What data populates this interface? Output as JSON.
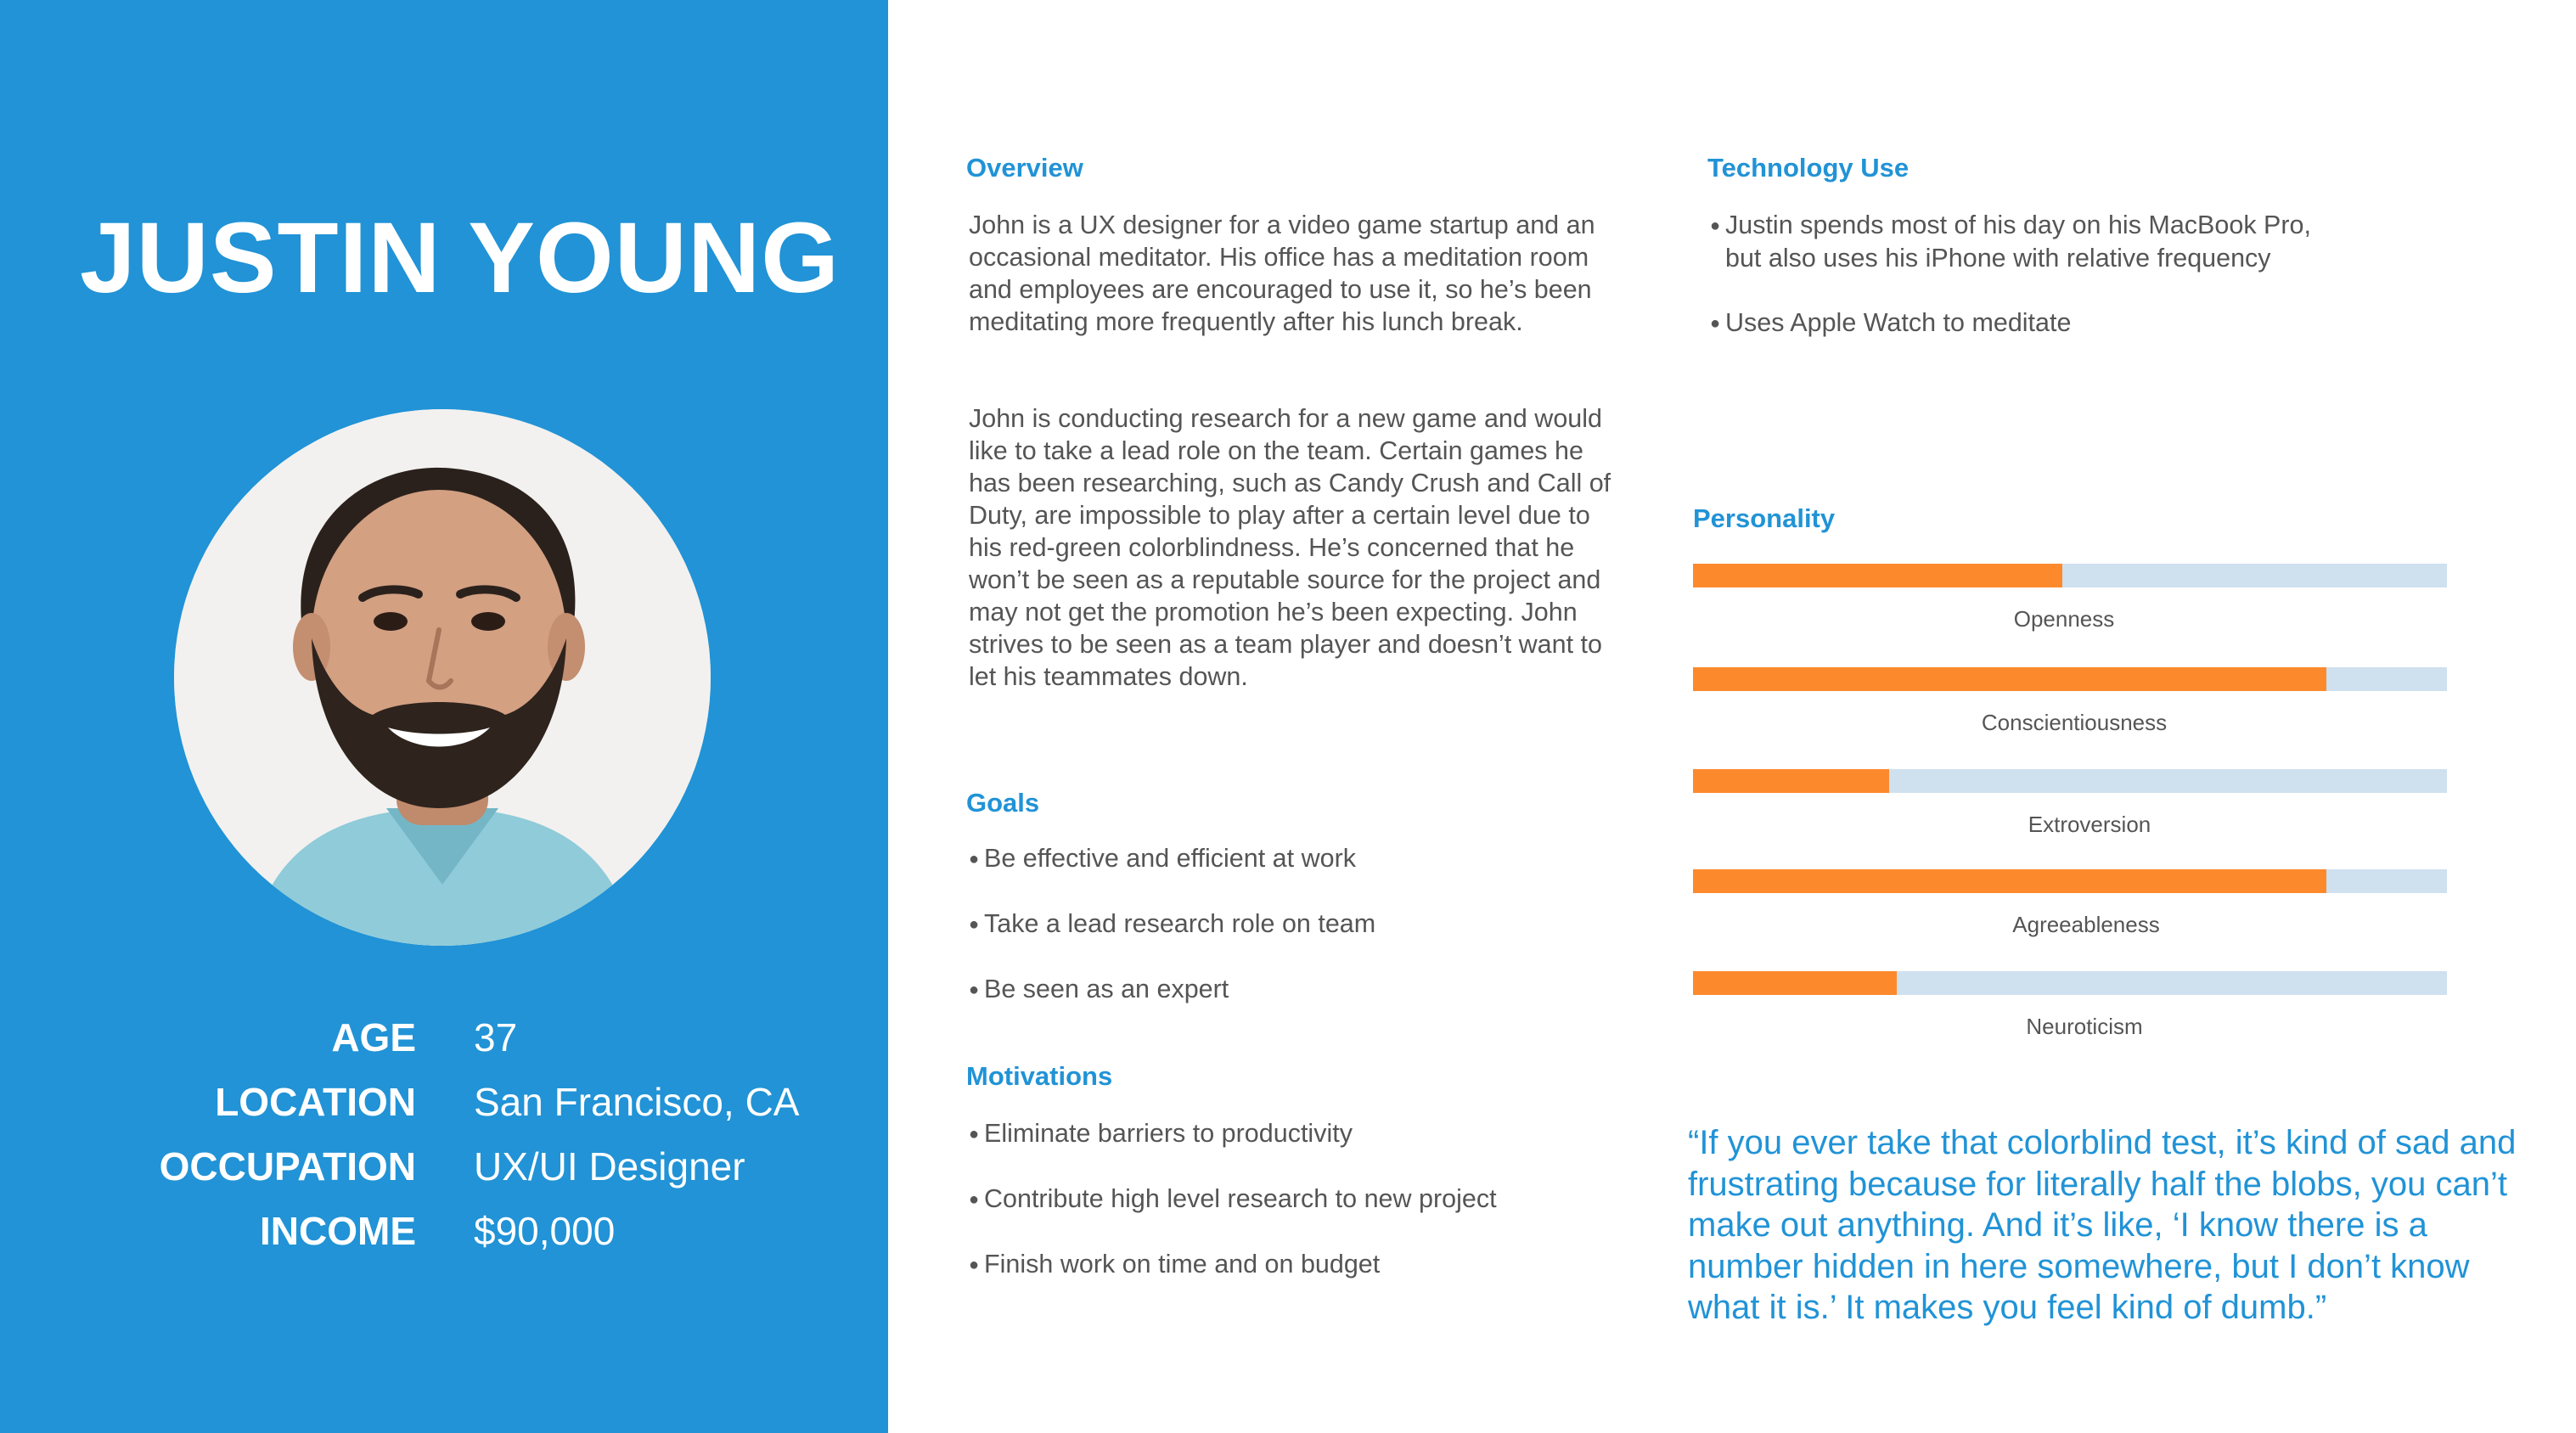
{
  "persona": {
    "name": "JUSTIN YOUNG",
    "facts": [
      {
        "label": "AGE",
        "value": "37"
      },
      {
        "label": "LOCATION",
        "value": "San Francisco, CA"
      },
      {
        "label": "OCCUPATION",
        "value": "UX/UI Designer"
      },
      {
        "label": "INCOME",
        "value": "$90,000"
      }
    ]
  },
  "overview": {
    "heading": "Overview",
    "paragraphs": [
      "John is a UX designer for a video game startup and an occasional meditator. His office has a meditation room and employees are encouraged to use it, so he’s been meditating more frequently after his lunch break.",
      "John is conducting research for a new game and would like to take a lead role on the team. Certain games he has been researching, such as Candy Crush and Call of Duty, are impossible to play after a certain level due to his red-green colorblindness. He’s concerned that he won’t be seen as a reputable source for the project and may not get the promotion he’s been expecting. John strives to be seen as a team player and doesn’t want to let his teammates down."
    ]
  },
  "goals": {
    "heading": "Goals",
    "items": [
      "Be effective and efficient at work",
      "Take a lead research role on team",
      "Be seen as an expert"
    ]
  },
  "motivations": {
    "heading": "Motivations",
    "items": [
      "Eliminate barriers to productivity",
      "Contribute high level research to new project",
      "Finish work on time and on budget"
    ]
  },
  "technology": {
    "heading": "Technology Use",
    "items": [
      "Justin spends most of his day on his MacBook Pro, but also uses his iPhone with relative frequency",
      "Uses Apple Watch to meditate"
    ]
  },
  "personality": {
    "heading": "Personality",
    "traits": [
      {
        "name": "Openness",
        "level": 0.49
      },
      {
        "name": "Conscientiousness",
        "level": 0.84
      },
      {
        "name": "Extroversion",
        "level": 0.26
      },
      {
        "name": "Agreeableness",
        "level": 0.84
      },
      {
        "name": "Neuroticism",
        "level": 0.27
      }
    ]
  },
  "quote": "“If you ever take that colorblind test, it’s kind of sad and frustrating because for literally half the blobs, you can’t make out anything. And it’s like, ‘I know there is a number hidden in here somewhere, but I don’t know what it is.’ It makes you feel kind of dumb.”",
  "colors": {
    "accent_blue": "#2193d6",
    "trait_fill": "#fc8a2d",
    "trait_track": "#cfe0ef",
    "body_text": "#555555"
  }
}
